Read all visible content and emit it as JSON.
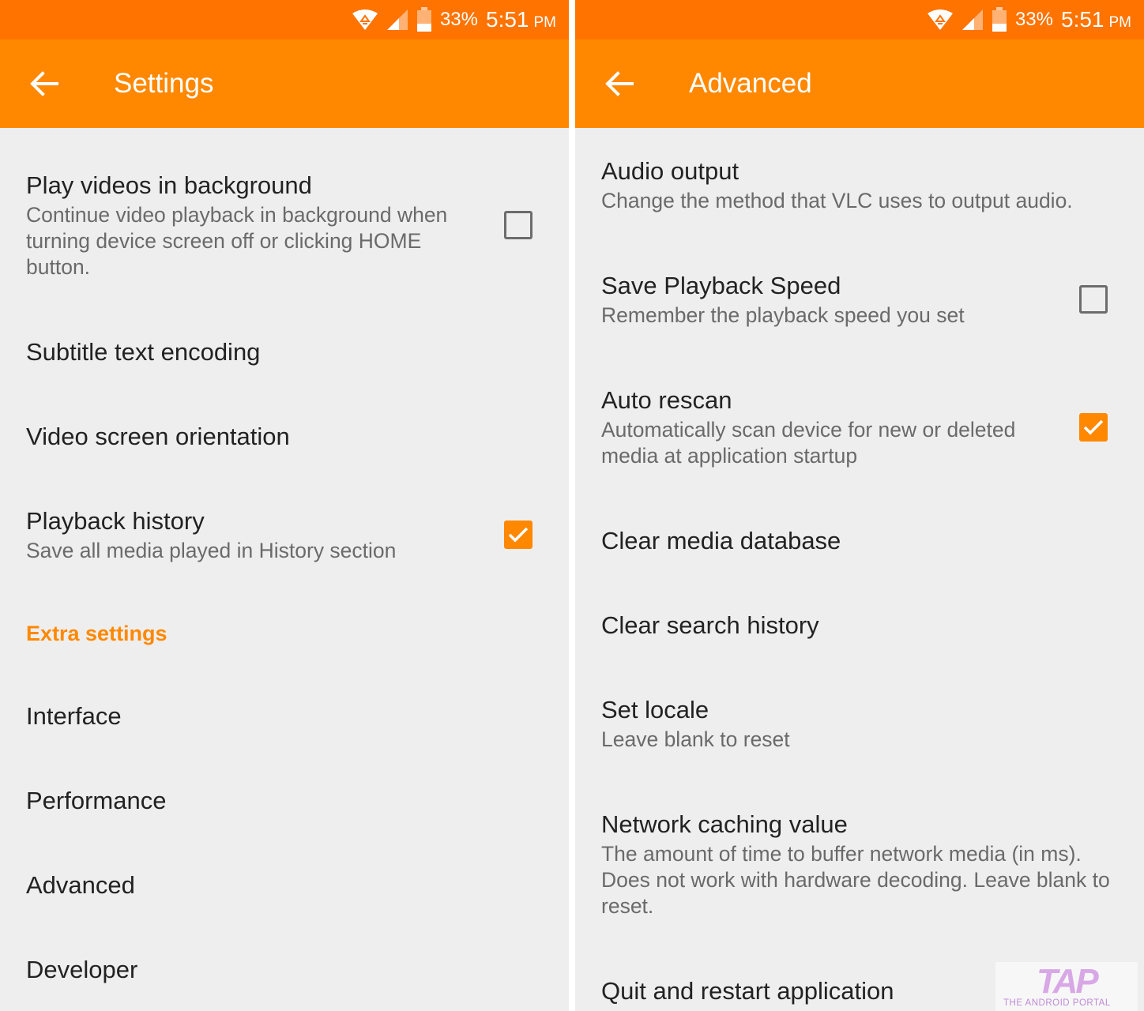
{
  "status_bar": {
    "battery_percent": "33%",
    "time": "5:51",
    "meridiem": "PM",
    "icons": [
      "wifi-icon",
      "signal-icon",
      "battery-icon"
    ]
  },
  "left_screen": {
    "title": "Settings",
    "items": [
      {
        "title": "Play videos in background",
        "summary": "Continue video playback in background when turning device screen off or clicking HOME button.",
        "checked": false
      },
      {
        "title": "Subtitle text encoding"
      },
      {
        "title": "Video screen orientation"
      },
      {
        "title": "Playback history",
        "summary": "Save all media played in History section",
        "checked": true
      }
    ],
    "category": "Extra settings",
    "extra_items": [
      {
        "title": "Interface"
      },
      {
        "title": "Performance"
      },
      {
        "title": "Advanced"
      },
      {
        "title": "Developer"
      }
    ]
  },
  "right_screen": {
    "title": "Advanced",
    "items": [
      {
        "title": "Audio output",
        "summary": "Change the method that VLC uses to output audio."
      },
      {
        "title": "Save Playback Speed",
        "summary": "Remember the playback speed you set",
        "checked": false
      },
      {
        "title": "Auto rescan",
        "summary": "Automatically scan device for new or deleted media at application startup",
        "checked": true
      },
      {
        "title": "Clear media database"
      },
      {
        "title": "Clear search history"
      },
      {
        "title": "Set locale",
        "summary": "Leave blank to reset"
      },
      {
        "title": "Network caching value",
        "summary": "The amount of time to buffer network media (in ms). Does not work with hardware decoding. Leave blank to reset."
      },
      {
        "title": "Quit and restart application"
      }
    ]
  },
  "watermark": {
    "logo": "TAP",
    "text": "THE ANDROID PORTAL"
  },
  "colors": {
    "status_bar": "#ff7300",
    "toolbar": "#ff8800",
    "accent": "#ff8800",
    "background": "#eeeeee"
  }
}
